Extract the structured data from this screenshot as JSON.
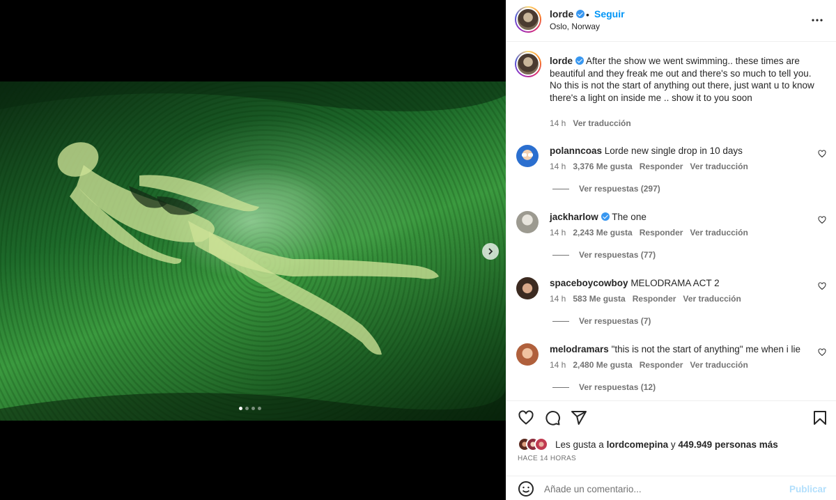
{
  "post": {
    "username": "lorde",
    "follow_label": "Seguir",
    "separator": "•",
    "location": "Oslo, Norway",
    "more_icon": "more-horizontal-icon",
    "carousel_count": 4,
    "carousel_active": 0
  },
  "caption": {
    "username": "lorde",
    "text": "After the show we went swimming.. these times are beautiful and they freak me out and there's so much to tell you. No this is not the start of anything out there, just want u to know there's a light on inside me .. show it to you soon",
    "time": "14 h",
    "translate_label": "Ver traducción"
  },
  "comments": [
    {
      "username": "polanncoas",
      "text": "Lorde new single drop in 10 days",
      "time": "14 h",
      "likes": "3,376 Me gusta",
      "reply_label": "Responder",
      "translate_label": "Ver traducción",
      "replies_label": "Ver respuestas (297)",
      "verified": false,
      "avatar_color": "#3a7bd5"
    },
    {
      "username": "jackharlow",
      "text": "The one",
      "time": "14 h",
      "likes": "2,243 Me gusta",
      "reply_label": "Responder",
      "translate_label": "Ver traducción",
      "replies_label": "Ver respuestas (77)",
      "verified": true,
      "avatar_color": "#b8b7b0"
    },
    {
      "username": "spaceboycowboy",
      "text": "MELODRAMA ACT 2",
      "time": "14 h",
      "likes": "583 Me gusta",
      "reply_label": "Responder",
      "translate_label": "Ver traducción",
      "replies_label": "Ver respuestas (7)",
      "verified": false,
      "avatar_color": "#6b5a45"
    },
    {
      "username": "melodramars",
      "text": "\"this is not the start of anything\" me when i lie",
      "time": "14 h",
      "likes": "2,480 Me gusta",
      "reply_label": "Responder",
      "translate_label": "Ver traducción",
      "replies_label": "Ver respuestas (12)",
      "verified": false,
      "avatar_color": "#c98a6a"
    }
  ],
  "actions": {
    "like_icon": "heart-icon",
    "comment_icon": "comment-icon",
    "share_icon": "send-icon",
    "save_icon": "bookmark-icon",
    "likes_prefix": "Les gusta a",
    "likes_user": "lordcomepina",
    "likes_connector": "y",
    "likes_count": "449.949 personas más",
    "time_ago": "HACE 14 HORAS"
  },
  "add_comment": {
    "emoji_icon": "emoji-icon",
    "placeholder": "Añade un comentario...",
    "publish_label": "Publicar"
  },
  "colors": {
    "accent": "#0095f6",
    "verified": "#3897f0",
    "publish_disabled": "#b2dffc",
    "muted_text": "#737373"
  }
}
